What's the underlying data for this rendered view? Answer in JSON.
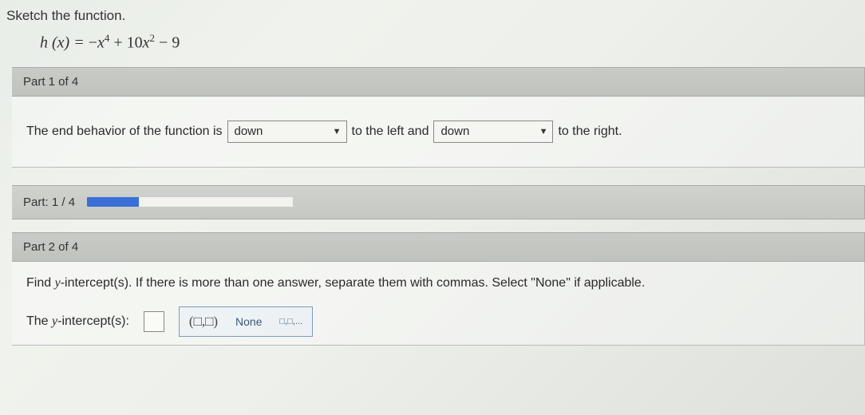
{
  "prompt": "Sketch the function.",
  "formula": {
    "lhs": "h (x) = ",
    "rhs_plain": "−x⁴ + 10x² − 9"
  },
  "part1": {
    "header": "Part 1 of 4",
    "sentence_a": "The end behavior of the function is",
    "dropdown_left": "down",
    "mid": "to the left and",
    "dropdown_right": "down",
    "sentence_b": "to the right."
  },
  "progress": {
    "label": "Part: 1 / 4",
    "percent": 25
  },
  "part2": {
    "header": "Part 2 of 4",
    "instruction": "Find y-intercept(s). If there is more than one answer, separate them with commas. Select \"None\" if applicable.",
    "line_label_prefix": "The ",
    "line_label_mid": "y",
    "line_label_suffix": "-intercept(s):",
    "tool_pair": "(□,□)",
    "tool_none": "None",
    "tool_list": "□,□,..."
  }
}
